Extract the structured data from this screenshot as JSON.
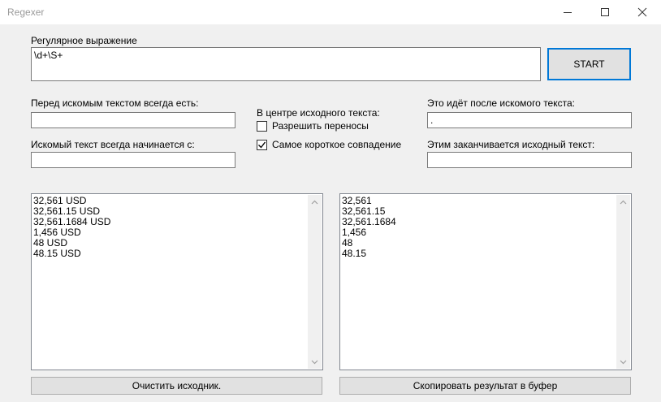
{
  "window": {
    "title": "Regexer"
  },
  "regex": {
    "label": "Регулярное выражение",
    "value": "\\d+\\S+"
  },
  "start_button": {
    "label": "START"
  },
  "before_text": {
    "label": "Перед искомым текстом всегда есть:",
    "value": ""
  },
  "center": {
    "label": "В центре исходного текста:",
    "allow_wrap": {
      "label": "Разрешить переносы",
      "checked": false
    },
    "shortest_match": {
      "label": "Самое короткое совпадение",
      "checked": true
    }
  },
  "after_text": {
    "label": "Это идёт после искомого текста:",
    "value": "."
  },
  "starts_with": {
    "label": "Искомый текст всегда начинается с:",
    "value": ""
  },
  "ends_with": {
    "label": "Этим заканчивается исходный текст:",
    "value": ""
  },
  "source_text": {
    "lines": [
      "32,561 USD",
      "32,561.15 USD",
      "32,561.1684 USD",
      "1,456 USD",
      "48 USD",
      "48.15 USD"
    ]
  },
  "result_text": {
    "lines": [
      "32,561",
      "32,561.15",
      "32,561.1684",
      "1,456",
      "48",
      "48.15"
    ]
  },
  "clear_button": {
    "label": "Очистить исходник."
  },
  "copy_button": {
    "label": "Скопировать результат в буфер"
  }
}
